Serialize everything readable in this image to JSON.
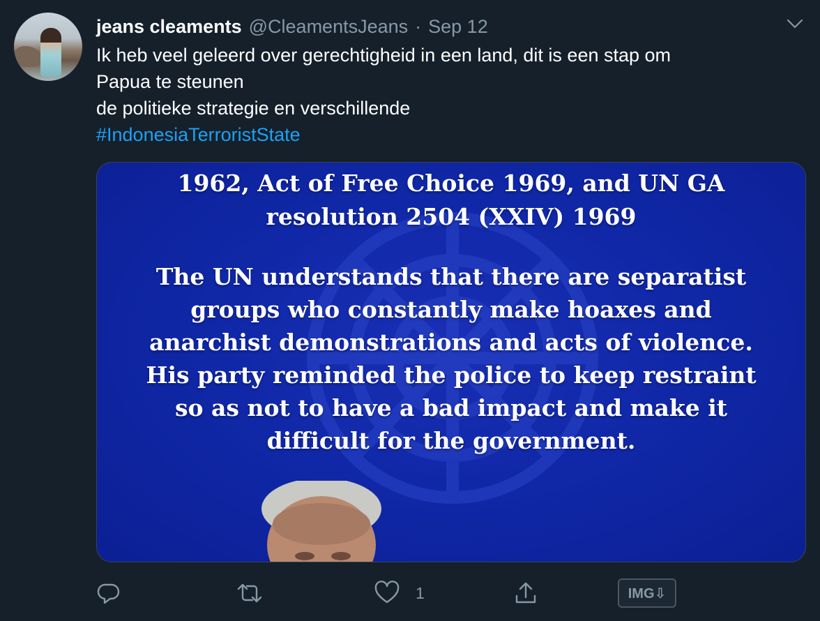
{
  "tweet": {
    "author_name": "jeans cleaments",
    "handle": "@CleamentsJeans",
    "separator": "·",
    "date": "Sep 12",
    "text_lines": [
      "Ik heb veel geleerd over gerechtigheid in een land, dit is een stap om",
      "Papua te steunen",
      "de politieke strategie en verschillende"
    ],
    "hashtag": "#IndonesiaTerroristState",
    "media": {
      "title_lines": [
        "1962, Act of Free Choice 1969, and UN GA",
        "resolution 2504 (XXIV) 1969"
      ],
      "body_lines": [
        "The UN understands that there are separatist",
        "groups who constantly make hoaxes and",
        "anarchist demonstrations and acts of violence.",
        "His party reminded the police to keep restraint",
        "so as not to have a bad impact and make it",
        "difficult for the government."
      ],
      "background_color": "#1028a8"
    },
    "actions": {
      "reply_icon": "reply-icon",
      "retweet_icon": "retweet-icon",
      "like_icon": "heart-icon",
      "like_count": "1",
      "share_icon": "share-icon",
      "img_download_label": "IMG⇩"
    }
  },
  "colors": {
    "background": "#15202b",
    "secondary_text": "#8899a6",
    "link": "#1da1f2"
  }
}
